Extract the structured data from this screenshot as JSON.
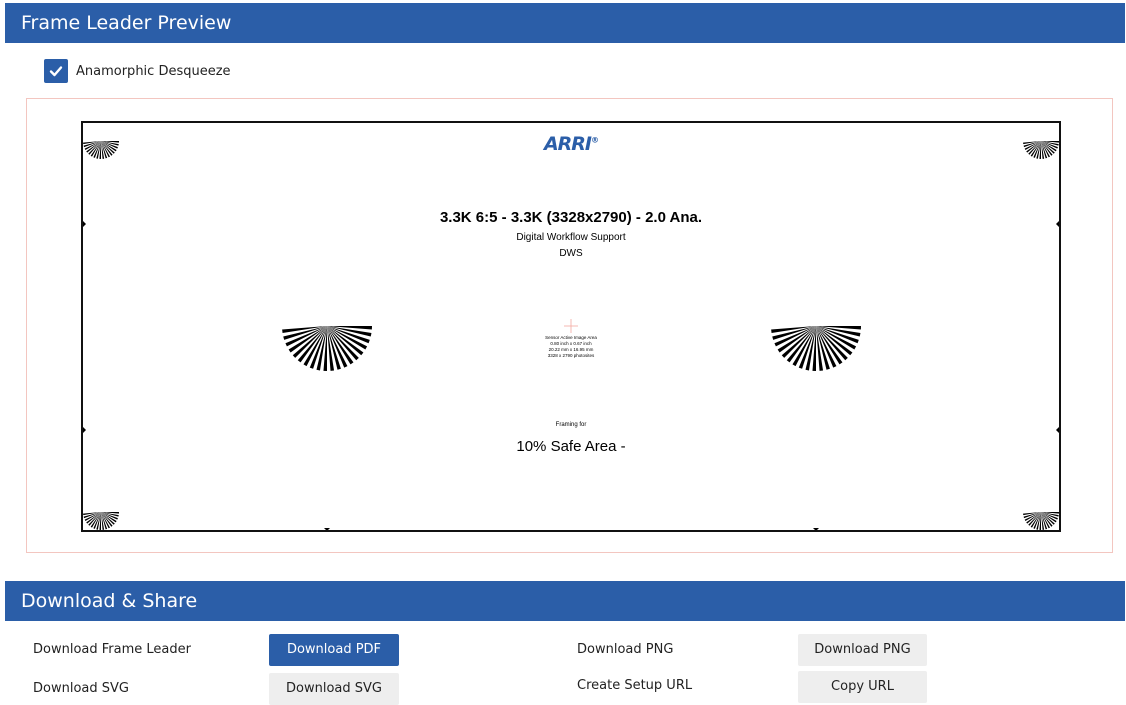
{
  "preview": {
    "title": "Frame Leader Preview",
    "anamorphic_label": "Anamorphic Desqueeze",
    "anamorphic_checked": true
  },
  "leader": {
    "logo": "ARRI",
    "title": "3.3K 6:5 - 3.3K (3328x2790) - 2.0 Ana.",
    "subtitle1": "Digital Workflow Support",
    "subtitle2": "DWS",
    "sensor_lines": [
      "Sensor Active Image Area",
      "0.80 inch x 0.67 inch",
      "20.22 mm x 16.95 mm",
      "3328 x 2790 photosites"
    ],
    "framing_for": "Framing for",
    "safe_area": "10% Safe Area -"
  },
  "download": {
    "title": "Download & Share",
    "frame_leader_label": "Download Frame Leader",
    "pdf_button": "Download PDF",
    "png_label": "Download PNG",
    "png_button": "Download PNG",
    "svg_label": "Download SVG",
    "svg_button": "Download SVG",
    "setup_url_label": "Create Setup URL",
    "copy_url_button": "Copy URL"
  },
  "colors": {
    "accent": "#2b5ea8",
    "preview_border": "#f3c6c0",
    "secondary_button": "#eeeeee"
  }
}
